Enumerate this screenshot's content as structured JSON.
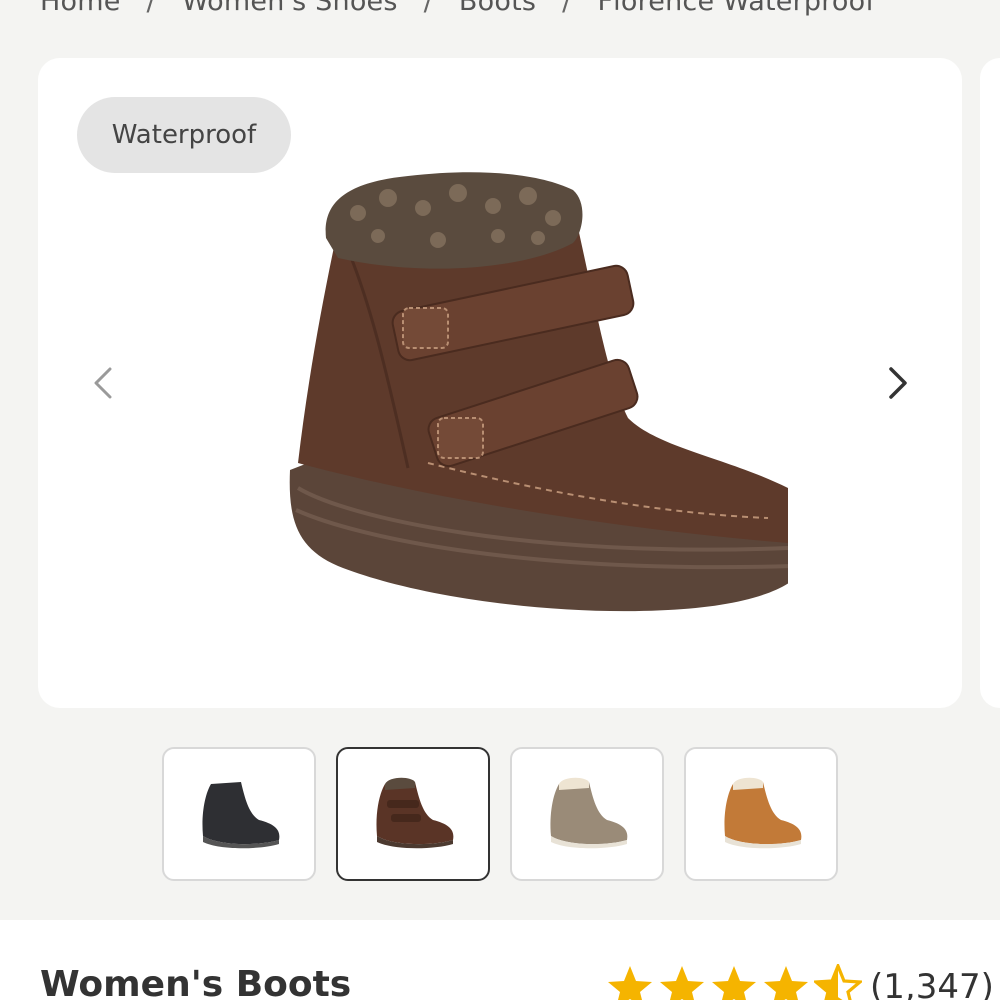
{
  "breadcrumb": [
    "Home",
    "Women's Shoes",
    "Boots",
    "Florence Waterproof"
  ],
  "gallery": {
    "badge": "Waterproof",
    "prev_icon": "chevron-left-icon",
    "next_icon": "chevron-right-icon",
    "main_image": "brown-boot-image",
    "thumbnails": [
      {
        "name": "black-boot-thumbnail",
        "color": "#2e2f33"
      },
      {
        "name": "brown-boot-thumbnail",
        "color": "#5a3426",
        "selected": true
      },
      {
        "name": "taupe-boot-thumbnail",
        "color": "#9a8b78"
      },
      {
        "name": "camel-boot-thumbnail",
        "color": "#c27a38"
      }
    ]
  },
  "product": {
    "title": "Women's Boots",
    "rating": 4.5,
    "rating_count": "(1,347)",
    "star_color": "#f5b400"
  }
}
